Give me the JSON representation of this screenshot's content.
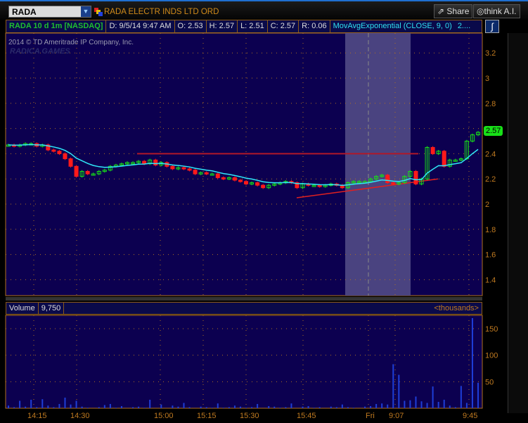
{
  "toolbar": {
    "symbol": "RADA",
    "company": "RADA ELECTR INDS LTD ORD",
    "share_label": "Share",
    "thinkai_label": "think A.I."
  },
  "header": {
    "title": "RADA 10 d 1m [NASDAQ]",
    "date": "D: 9/5/14 9:47 AM",
    "open": "O: 2.53",
    "high": "H: 2.57",
    "low": "L: 2.51",
    "close": "C: 2.57",
    "range": "R: 0.06",
    "study": "MovAvgExponential (CLOSE, 9, 0)",
    "more": "2...."
  },
  "copyright": "2014 © TD Ameritrade IP Company, Inc.",
  "watermark": "RADICA GAMES",
  "last_price": "2.57",
  "volume": {
    "label": "Volume",
    "value": "9,750",
    "units": "<thousands>"
  },
  "colors": {
    "up": "#18e018",
    "down": "#ff1a1a",
    "ema": "#2fe8f8",
    "bg": "#0c0050",
    "grid": "#b07020",
    "volume": "#1e3ed8"
  },
  "chart_data": {
    "type": "candlestick",
    "title": "RADA 10 d 1m [NASDAQ]",
    "price_axis": {
      "ylim": [
        1.3,
        3.3
      ],
      "ticks": [
        "3.2",
        "3",
        "2.8",
        "2.6",
        "2.4",
        "2.2",
        "2",
        "1.8",
        "1.6",
        "1.4"
      ]
    },
    "volume_axis": {
      "ylim": [
        0,
        175
      ],
      "ticks": [
        "150",
        "100",
        "50"
      ]
    },
    "time_labels": [
      "14:15",
      "14:30",
      "15:00",
      "15:15",
      "15:30",
      "15:45",
      "Fri",
      "9:07",
      "9:45"
    ],
    "closes": [
      2.47,
      2.46,
      2.47,
      2.48,
      2.48,
      2.46,
      2.47,
      2.43,
      2.42,
      2.4,
      2.36,
      2.3,
      2.22,
      2.26,
      2.24,
      2.24,
      2.26,
      2.27,
      2.3,
      2.31,
      2.32,
      2.33,
      2.33,
      2.34,
      2.32,
      2.35,
      2.31,
      2.33,
      2.3,
      2.28,
      2.29,
      2.28,
      2.27,
      2.24,
      2.25,
      2.24,
      2.24,
      2.21,
      2.2,
      2.21,
      2.19,
      2.18,
      2.16,
      2.17,
      2.15,
      2.13,
      2.15,
      2.16,
      2.17,
      2.18,
      2.17,
      2.13,
      2.16,
      2.15,
      2.15,
      2.14,
      2.15,
      2.16,
      2.15,
      2.13,
      2.17,
      2.18,
      2.18,
      2.18,
      2.2,
      2.22,
      2.23,
      2.17,
      2.16,
      2.17,
      2.22,
      2.26,
      2.16,
      2.2,
      2.45,
      2.4,
      2.42,
      2.3,
      2.35,
      2.35,
      2.36,
      2.5,
      2.55,
      2.57
    ],
    "volumes": [
      5,
      2,
      14,
      3,
      16,
      2,
      17,
      5,
      2,
      8,
      20,
      7,
      14,
      3,
      1,
      0,
      2,
      6,
      8,
      1,
      4,
      0,
      2,
      3,
      1,
      16,
      0,
      7,
      0,
      5,
      3,
      10,
      2,
      0,
      3,
      2,
      1,
      9,
      1,
      2,
      5,
      3,
      1,
      2,
      8,
      0,
      4,
      3,
      1,
      2,
      9,
      0,
      3,
      4,
      1,
      2,
      0,
      3,
      2,
      7,
      2,
      1,
      0,
      3,
      4,
      8,
      9,
      7,
      83,
      63,
      14,
      15,
      22,
      13,
      10,
      41,
      12,
      16,
      5,
      2,
      42,
      10,
      170,
      48
    ],
    "ema_study": "MovAvgExponential (CLOSE, 9, 0)",
    "resistance": 2.4,
    "trendline": [
      2.05,
      2.2
    ]
  }
}
